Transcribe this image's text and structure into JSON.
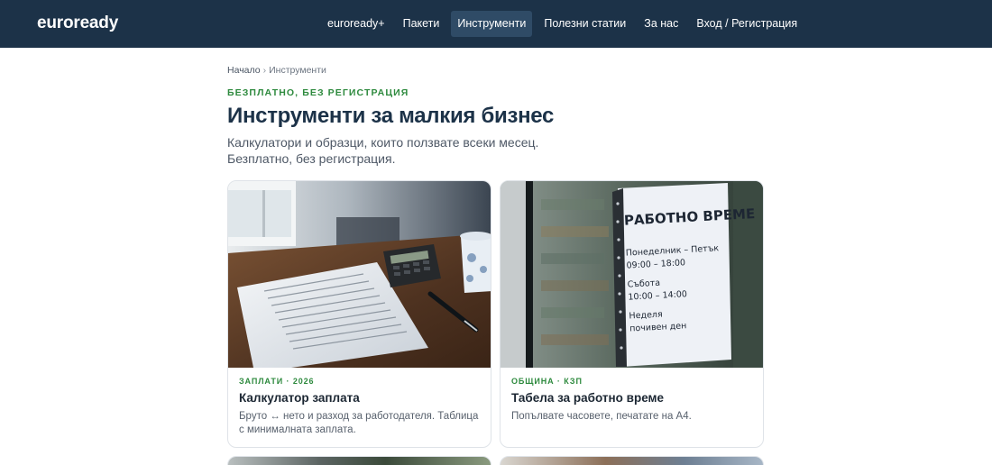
{
  "header": {
    "brand": "euroready",
    "nav": [
      {
        "label": "euroready+"
      },
      {
        "label": "Пакети"
      },
      {
        "label": "Инструменти"
      },
      {
        "label": "Полезни статии"
      },
      {
        "label": "За нас"
      },
      {
        "label": "Вход / Регистрация"
      }
    ],
    "active_index": 2
  },
  "breadcrumb": {
    "home": "Начало",
    "separator": "›",
    "current": "Инструменти"
  },
  "hero": {
    "eyebrow": "БЕЗПЛАТНО, БЕЗ РЕГИСТРАЦИЯ",
    "title": "Инструменти за малкия бизнес",
    "lead": "Калкулатори и образци, които ползвате всеки месец. Безплатно, без регистрация."
  },
  "cards": [
    {
      "tag": "ЗАПЛАТИ · 2026",
      "title": "Калкулатор заплата",
      "description": "Бруто ↔ нето и разход за работодателя. Таблица с минималната заплата."
    },
    {
      "tag": "ОБЩИНА · КЗП",
      "title": "Табела за работно време",
      "description": "Попълвате часовете, печатате на А4.",
      "image_sign": {
        "heading": "РАБОТНО ВРЕМЕ",
        "line1": "Понеделник – Петък",
        "line2": "09:00 – 18:00",
        "line3": "Събота",
        "line4": "10:00 – 14:00",
        "line5": "Неделя",
        "line6": "почивен ден"
      }
    }
  ],
  "colors": {
    "header_bg": "#1c3248",
    "nav_active_bg": "#2f4b66",
    "accent_green": "#2e8a3e",
    "title_navy": "#1c3248"
  }
}
